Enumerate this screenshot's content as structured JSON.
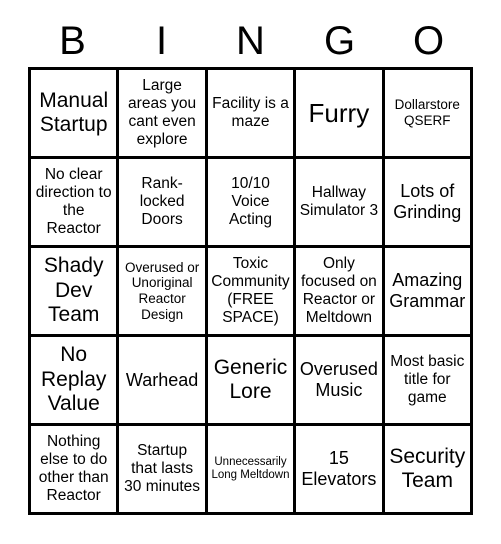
{
  "header": {
    "letters": [
      "B",
      "I",
      "N",
      "G",
      "O"
    ]
  },
  "grid": {
    "rows": 5,
    "columns": 5,
    "free_space_index": 12,
    "cells": [
      {
        "text": "Manual Startup",
        "size": "xl"
      },
      {
        "text": "Large areas you cant even explore",
        "size": "md"
      },
      {
        "text": "Facility is a maze",
        "size": "md"
      },
      {
        "text": "Furry",
        "size": "xxl"
      },
      {
        "text": "Dollarstore QSERF",
        "size": "sm"
      },
      {
        "text": "No clear direction to the Reactor",
        "size": "md"
      },
      {
        "text": "Rank-locked Doors",
        "size": "md"
      },
      {
        "text": "10/10 Voice Acting",
        "size": "md"
      },
      {
        "text": "Hallway Simulator 3",
        "size": "md"
      },
      {
        "text": "Lots of Grinding",
        "size": "lg"
      },
      {
        "text": "Shady Dev Team",
        "size": "xl"
      },
      {
        "text": "Overused or Unoriginal Reactor Design",
        "size": "sm"
      },
      {
        "text": "Toxic Community (FREE SPACE)",
        "size": "md"
      },
      {
        "text": "Only focused on Reactor or Meltdown",
        "size": "md"
      },
      {
        "text": "Amazing Grammar",
        "size": "lg"
      },
      {
        "text": "No Replay Value",
        "size": "xl"
      },
      {
        "text": "Warhead",
        "size": "lg"
      },
      {
        "text": "Generic Lore",
        "size": "xl"
      },
      {
        "text": "Overused Music",
        "size": "lg"
      },
      {
        "text": "Most basic title for game",
        "size": "md"
      },
      {
        "text": "Nothing else to do other than Reactor",
        "size": "md"
      },
      {
        "text": "Startup that lasts 30 minutes",
        "size": "md"
      },
      {
        "text": "Unnecessarily Long Meltdown",
        "size": "xs"
      },
      {
        "text": "15 Elevators",
        "size": "lg"
      },
      {
        "text": "Security Team",
        "size": "xl"
      }
    ]
  },
  "colors": {
    "background": "#ffffff",
    "border": "#000000",
    "text": "#000000"
  }
}
